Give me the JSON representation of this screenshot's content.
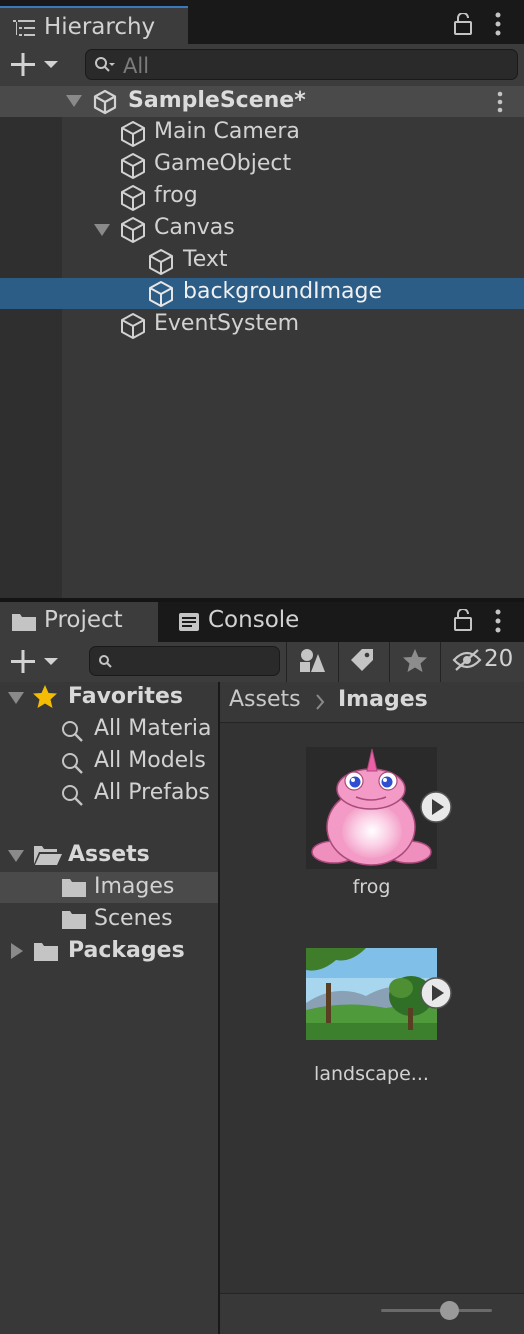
{
  "hierarchy": {
    "tab_label": "Hierarchy",
    "search_placeholder": "All",
    "scene_name": "SampleScene*",
    "items": [
      "Main Camera",
      "GameObject",
      "frog",
      "Canvas",
      "Text",
      "backgroundImage",
      "EventSystem"
    ]
  },
  "project": {
    "tab_label": "Project",
    "console_tab_label": "Console",
    "hidden_count": "20",
    "favorites": {
      "label": "Favorites",
      "items": [
        "All Materia",
        "All Models",
        "All Prefabs"
      ]
    },
    "assets_label": "Assets",
    "asset_folders": [
      "Images",
      "Scenes"
    ],
    "packages_label": "Packages",
    "breadcrumb": {
      "root": "Assets",
      "current": "Images"
    },
    "assets": [
      {
        "name": "frog"
      },
      {
        "name": "landscape..."
      }
    ],
    "zoom_level": 0.62
  },
  "colors": {
    "selection": "#2c5d87",
    "panel": "#383838",
    "tab_accent": "#3a79bb"
  }
}
